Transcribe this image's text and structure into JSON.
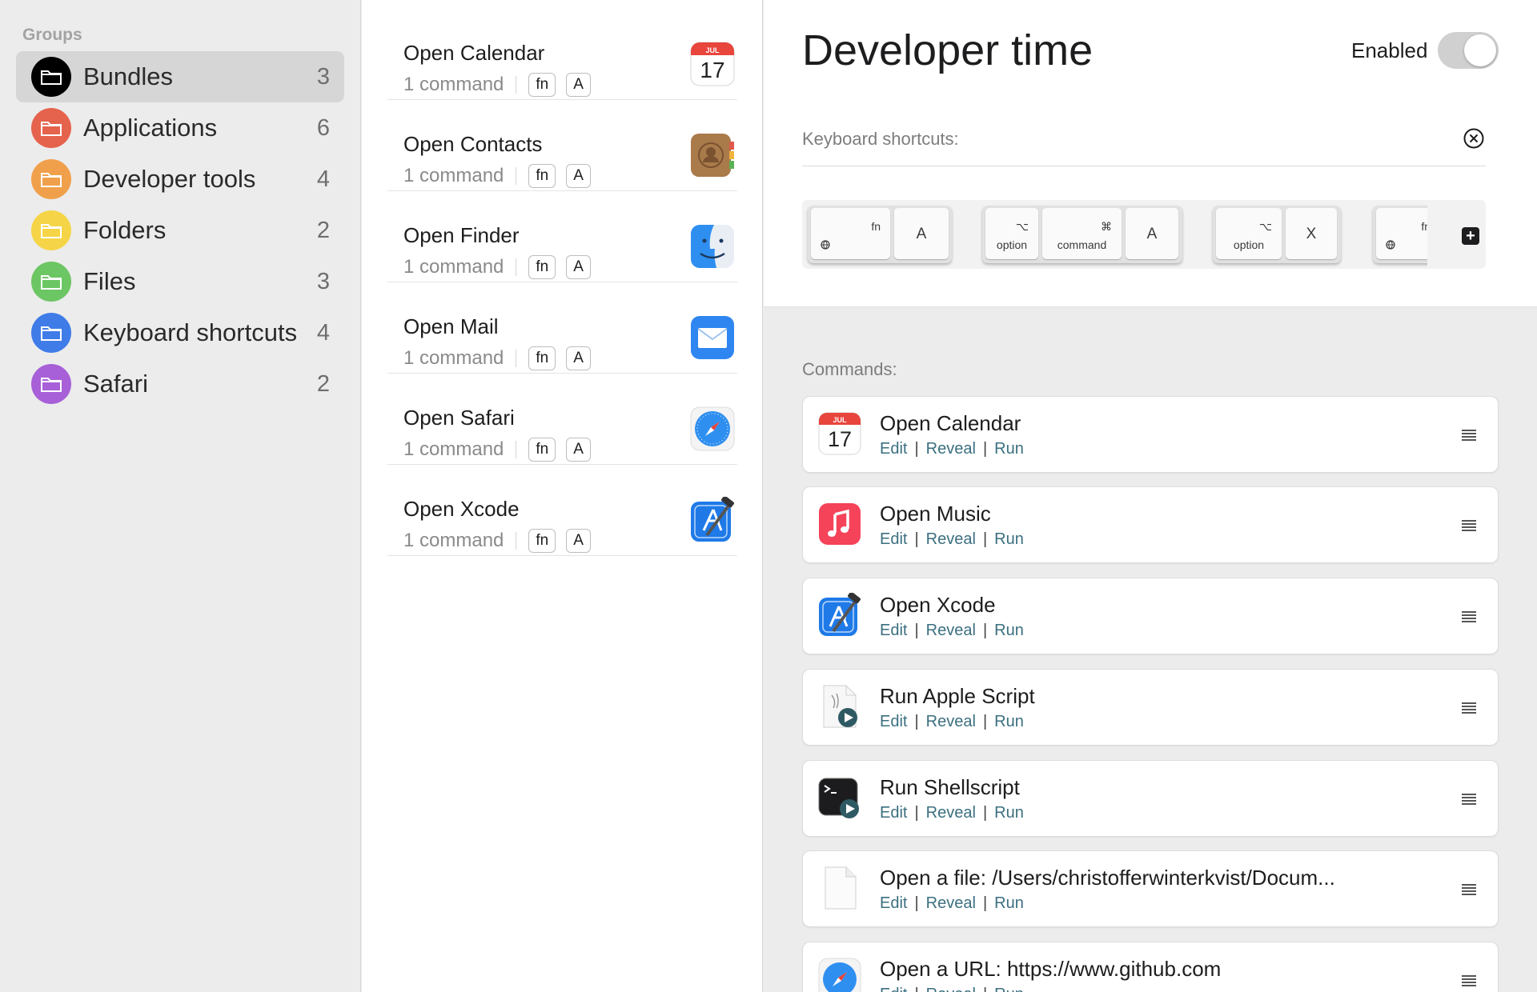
{
  "sidebar": {
    "header": "Groups",
    "items": [
      {
        "label": "Bundles",
        "count": "3",
        "color": "#000000",
        "selected": true
      },
      {
        "label": "Applications",
        "count": "6",
        "color": "#e5634d"
      },
      {
        "label": "Developer tools",
        "count": "4",
        "color": "#f0a04b"
      },
      {
        "label": "Folders",
        "count": "2",
        "color": "#f5d547"
      },
      {
        "label": "Files",
        "count": "3",
        "color": "#6cc663"
      },
      {
        "label": "Keyboard shortcuts",
        "count": "4",
        "color": "#3f7ce8"
      },
      {
        "label": "Safari",
        "count": "2",
        "color": "#a760d8"
      }
    ]
  },
  "list": {
    "items": [
      {
        "title": "Open Calendar",
        "count": "1 command",
        "key1": "fn",
        "key2": "A",
        "icon": "calendar-icon"
      },
      {
        "title": "Open Contacts",
        "count": "1 command",
        "key1": "fn",
        "key2": "A",
        "icon": "contacts-icon"
      },
      {
        "title": "Open Finder",
        "count": "1 command",
        "key1": "fn",
        "key2": "A",
        "icon": "finder-icon"
      },
      {
        "title": "Open Mail",
        "count": "1 command",
        "key1": "fn",
        "key2": "A",
        "icon": "mail-icon"
      },
      {
        "title": "Open Safari",
        "count": "1 command",
        "key1": "fn",
        "key2": "A",
        "icon": "safari-icon"
      },
      {
        "title": "Open Xcode",
        "count": "1 command",
        "key1": "fn",
        "key2": "A",
        "icon": "xcode-icon"
      }
    ]
  },
  "calendar_icon": {
    "month": "JUL",
    "day": "17"
  },
  "detail": {
    "title": "Developer time",
    "enabled_label": "Enabled",
    "enabled": false,
    "shortcuts_label": "Keyboard shortcuts:",
    "shortcuts": {
      "fn": "fn",
      "a": "A",
      "option_glyph": "⌥",
      "option": "option",
      "command_glyph": "⌘",
      "command": "command",
      "x": "X"
    },
    "commands_label": "Commands:",
    "actions": {
      "edit": "Edit",
      "reveal": "Reveal",
      "run": "Run",
      "sep": "|"
    },
    "commands": [
      {
        "title": "Open Calendar",
        "icon": "calendar-icon"
      },
      {
        "title": "Open Music",
        "icon": "music-icon"
      },
      {
        "title": "Open Xcode",
        "icon": "xcode-icon"
      },
      {
        "title": "Run Apple Script",
        "icon": "applescript-icon"
      },
      {
        "title": "Run Shellscript",
        "icon": "terminal-icon"
      },
      {
        "title": "Open a file: /Users/christofferwinterkvist/Docum...",
        "icon": "file-icon"
      },
      {
        "title": "Open a URL: https://www.github.com",
        "icon": "safari-icon"
      }
    ]
  }
}
